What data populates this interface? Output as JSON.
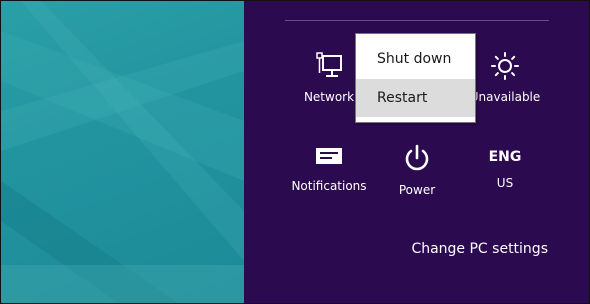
{
  "settings_charm": {
    "tiles": {
      "network": {
        "label": "Network",
        "icon": "network-icon"
      },
      "brightness": {
        "label": "Unavailable",
        "icon": "brightness-icon"
      },
      "notifications": {
        "label": "Notifications",
        "icon": "notifications-icon"
      },
      "power": {
        "label": "Power",
        "icon": "power-icon"
      },
      "language": {
        "code": "ENG",
        "label": "US"
      }
    },
    "change_pc_settings": "Change PC settings"
  },
  "power_menu": {
    "items": [
      {
        "label": "Shut down",
        "highlighted": false
      },
      {
        "label": "Restart",
        "highlighted": true
      }
    ]
  },
  "colors": {
    "charm_background": "#2c0a50",
    "wallpaper": "#2294a0",
    "menu_highlight": "#dcdcdc"
  }
}
